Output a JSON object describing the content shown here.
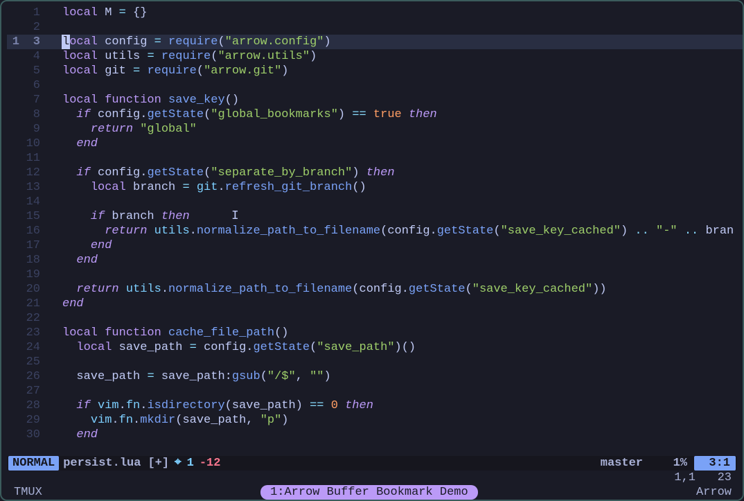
{
  "cursor": {
    "row": 3,
    "rel": 1
  },
  "code": {
    "lines": [
      {
        "n": 1,
        "tokens": [
          [
            "kw",
            "local"
          ],
          [
            "punc",
            " "
          ],
          [
            "var",
            "M"
          ],
          [
            "punc",
            " "
          ],
          [
            "op",
            "="
          ],
          [
            "punc",
            " {}"
          ]
        ]
      },
      {
        "n": 2,
        "tokens": []
      },
      {
        "n": 3,
        "current": true,
        "tokens": [
          [
            "cursor",
            "l"
          ],
          [
            "kw",
            "ocal"
          ],
          [
            "punc",
            " "
          ],
          [
            "var",
            "config"
          ],
          [
            "punc",
            " "
          ],
          [
            "op",
            "="
          ],
          [
            "punc",
            " "
          ],
          [
            "fn",
            "require"
          ],
          [
            "punc",
            "("
          ],
          [
            "str",
            "\"arrow.config\""
          ],
          [
            "punc",
            ")"
          ]
        ]
      },
      {
        "n": 4,
        "tokens": [
          [
            "kw",
            "local"
          ],
          [
            "punc",
            " "
          ],
          [
            "var",
            "utils"
          ],
          [
            "punc",
            " "
          ],
          [
            "op",
            "="
          ],
          [
            "punc",
            " "
          ],
          [
            "fn",
            "require"
          ],
          [
            "punc",
            "("
          ],
          [
            "str",
            "\"arrow.utils\""
          ],
          [
            "punc",
            ")"
          ]
        ]
      },
      {
        "n": 5,
        "tokens": [
          [
            "kw",
            "local"
          ],
          [
            "punc",
            " "
          ],
          [
            "var",
            "git"
          ],
          [
            "punc",
            " "
          ],
          [
            "op",
            "="
          ],
          [
            "punc",
            " "
          ],
          [
            "fn",
            "require"
          ],
          [
            "punc",
            "("
          ],
          [
            "str",
            "\"arrow.git\""
          ],
          [
            "punc",
            ")"
          ]
        ]
      },
      {
        "n": 6,
        "tokens": []
      },
      {
        "n": 7,
        "tokens": [
          [
            "kw",
            "local"
          ],
          [
            "punc",
            " "
          ],
          [
            "kw",
            "function"
          ],
          [
            "punc",
            " "
          ],
          [
            "fn",
            "save_key"
          ],
          [
            "punc",
            "()"
          ]
        ]
      },
      {
        "n": 8,
        "tokens": [
          [
            "punc",
            "  "
          ],
          [
            "kw-i",
            "if"
          ],
          [
            "punc",
            " "
          ],
          [
            "var",
            "config"
          ],
          [
            "punc",
            "."
          ],
          [
            "fn",
            "getState"
          ],
          [
            "punc",
            "("
          ],
          [
            "str",
            "\"global_bookmarks\""
          ],
          [
            "punc",
            ") "
          ],
          [
            "op",
            "=="
          ],
          [
            "punc",
            " "
          ],
          [
            "bool",
            "true"
          ],
          [
            "punc",
            " "
          ],
          [
            "kw-i",
            "then"
          ]
        ]
      },
      {
        "n": 9,
        "tokens": [
          [
            "punc",
            "    "
          ],
          [
            "kw-i",
            "return"
          ],
          [
            "punc",
            " "
          ],
          [
            "str",
            "\"global\""
          ]
        ]
      },
      {
        "n": 10,
        "tokens": [
          [
            "punc",
            "  "
          ],
          [
            "kw-i",
            "end"
          ]
        ]
      },
      {
        "n": 11,
        "tokens": []
      },
      {
        "n": 12,
        "tokens": [
          [
            "punc",
            "  "
          ],
          [
            "kw-i",
            "if"
          ],
          [
            "punc",
            " "
          ],
          [
            "var",
            "config"
          ],
          [
            "punc",
            "."
          ],
          [
            "fn",
            "getState"
          ],
          [
            "punc",
            "("
          ],
          [
            "str",
            "\"separate_by_branch\""
          ],
          [
            "punc",
            ") "
          ],
          [
            "kw-i",
            "then"
          ]
        ]
      },
      {
        "n": 13,
        "tokens": [
          [
            "punc",
            "    "
          ],
          [
            "kw",
            "local"
          ],
          [
            "punc",
            " "
          ],
          [
            "var",
            "branch"
          ],
          [
            "punc",
            " "
          ],
          [
            "op",
            "="
          ],
          [
            "punc",
            " "
          ],
          [
            "id",
            "git"
          ],
          [
            "punc",
            "."
          ],
          [
            "fn",
            "refresh_git_branch"
          ],
          [
            "punc",
            "()"
          ]
        ]
      },
      {
        "n": 14,
        "tokens": []
      },
      {
        "n": 15,
        "tokens": [
          [
            "punc",
            "    "
          ],
          [
            "kw-i",
            "if"
          ],
          [
            "punc",
            " "
          ],
          [
            "var",
            "branch"
          ],
          [
            "punc",
            " "
          ],
          [
            "kw-i",
            "then"
          ]
        ]
      },
      {
        "n": 16,
        "tokens": [
          [
            "punc",
            "      "
          ],
          [
            "kw-i",
            "return"
          ],
          [
            "punc",
            " "
          ],
          [
            "id",
            "utils"
          ],
          [
            "punc",
            "."
          ],
          [
            "fn",
            "normalize_path_to_filename"
          ],
          [
            "punc",
            "("
          ],
          [
            "var",
            "config"
          ],
          [
            "punc",
            "."
          ],
          [
            "fn",
            "getState"
          ],
          [
            "punc",
            "("
          ],
          [
            "str",
            "\"save_key_cached\""
          ],
          [
            "punc",
            ") "
          ],
          [
            "op",
            ".."
          ],
          [
            "punc",
            " "
          ],
          [
            "str",
            "\"-\""
          ],
          [
            "punc",
            " "
          ],
          [
            "op",
            ".."
          ],
          [
            "punc",
            " "
          ],
          [
            "var",
            "bran"
          ]
        ]
      },
      {
        "n": 17,
        "tokens": [
          [
            "punc",
            "    "
          ],
          [
            "kw-i",
            "end"
          ]
        ]
      },
      {
        "n": 18,
        "tokens": [
          [
            "punc",
            "  "
          ],
          [
            "kw-i",
            "end"
          ]
        ]
      },
      {
        "n": 19,
        "tokens": []
      },
      {
        "n": 20,
        "tokens": [
          [
            "punc",
            "  "
          ],
          [
            "kw-i",
            "return"
          ],
          [
            "punc",
            " "
          ],
          [
            "id",
            "utils"
          ],
          [
            "punc",
            "."
          ],
          [
            "fn",
            "normalize_path_to_filename"
          ],
          [
            "punc",
            "("
          ],
          [
            "var",
            "config"
          ],
          [
            "punc",
            "."
          ],
          [
            "fn",
            "getState"
          ],
          [
            "punc",
            "("
          ],
          [
            "str",
            "\"save_key_cached\""
          ],
          [
            "punc",
            "))"
          ]
        ]
      },
      {
        "n": 21,
        "tokens": [
          [
            "kw-i",
            "end"
          ]
        ]
      },
      {
        "n": 22,
        "tokens": []
      },
      {
        "n": 23,
        "tokens": [
          [
            "kw",
            "local"
          ],
          [
            "punc",
            " "
          ],
          [
            "kw",
            "function"
          ],
          [
            "punc",
            " "
          ],
          [
            "fn",
            "cache_file_path"
          ],
          [
            "punc",
            "()"
          ]
        ]
      },
      {
        "n": 24,
        "tokens": [
          [
            "punc",
            "  "
          ],
          [
            "kw",
            "local"
          ],
          [
            "punc",
            " "
          ],
          [
            "var",
            "save_path"
          ],
          [
            "punc",
            " "
          ],
          [
            "op",
            "="
          ],
          [
            "punc",
            " "
          ],
          [
            "var",
            "config"
          ],
          [
            "punc",
            "."
          ],
          [
            "fn",
            "getState"
          ],
          [
            "punc",
            "("
          ],
          [
            "str",
            "\"save_path\""
          ],
          [
            "punc",
            ")()"
          ]
        ]
      },
      {
        "n": 25,
        "tokens": []
      },
      {
        "n": 26,
        "tokens": [
          [
            "punc",
            "  "
          ],
          [
            "var",
            "save_path"
          ],
          [
            "punc",
            " "
          ],
          [
            "op",
            "="
          ],
          [
            "punc",
            " "
          ],
          [
            "var",
            "save_path"
          ],
          [
            "punc",
            ":"
          ],
          [
            "fn",
            "gsub"
          ],
          [
            "punc",
            "("
          ],
          [
            "str",
            "\"/$\""
          ],
          [
            "punc",
            ", "
          ],
          [
            "str",
            "\"\""
          ],
          [
            "punc",
            ")"
          ]
        ]
      },
      {
        "n": 27,
        "tokens": []
      },
      {
        "n": 28,
        "tokens": [
          [
            "punc",
            "  "
          ],
          [
            "kw-i",
            "if"
          ],
          [
            "punc",
            " "
          ],
          [
            "id",
            "vim"
          ],
          [
            "punc",
            "."
          ],
          [
            "id",
            "fn"
          ],
          [
            "punc",
            "."
          ],
          [
            "fn",
            "isdirectory"
          ],
          [
            "punc",
            "("
          ],
          [
            "var",
            "save_path"
          ],
          [
            "punc",
            ") "
          ],
          [
            "op",
            "=="
          ],
          [
            "punc",
            " "
          ],
          [
            "num",
            "0"
          ],
          [
            "punc",
            " "
          ],
          [
            "kw-i",
            "then"
          ]
        ]
      },
      {
        "n": 29,
        "tokens": [
          [
            "punc",
            "    "
          ],
          [
            "id",
            "vim"
          ],
          [
            "punc",
            "."
          ],
          [
            "id",
            "fn"
          ],
          [
            "punc",
            "."
          ],
          [
            "fn",
            "mkdir"
          ],
          [
            "punc",
            "("
          ],
          [
            "var",
            "save_path"
          ],
          [
            "punc",
            ", "
          ],
          [
            "str",
            "\"p\""
          ],
          [
            "punc",
            ")"
          ]
        ]
      },
      {
        "n": 30,
        "tokens": [
          [
            "punc",
            "  "
          ],
          [
            "kw-i",
            "end"
          ]
        ]
      }
    ]
  },
  "status": {
    "mode": "NORMAL",
    "file": "persist.lua",
    "modified": "[+]",
    "target_glyph": "⌖",
    "target_count": "1",
    "diag": "-12",
    "branch_glyph": "",
    "branch": "master",
    "percent": "1%",
    "pos": "3:1"
  },
  "ruler": {
    "pos": "1,1",
    "len": "23"
  },
  "tmux": {
    "left": "TMUX",
    "tab": "1:Arrow Buffer Bookmark Demo",
    "right": "Arrow"
  }
}
